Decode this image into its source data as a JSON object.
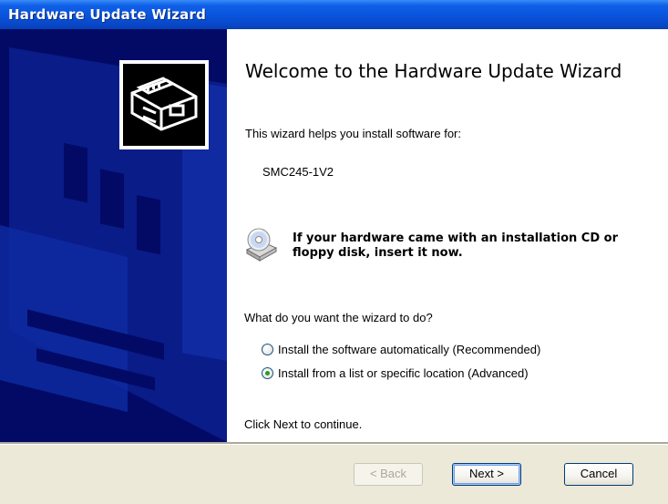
{
  "window": {
    "title": "Hardware Update Wizard"
  },
  "content": {
    "heading": "Welcome to the Hardware Update Wizard",
    "intro": "This wizard helps you install software for:",
    "device": "SMC245-1V2",
    "cd_note": "If your hardware came with an installation CD or floppy disk, insert it now.",
    "question": "What do you want the wizard to do?",
    "options": [
      {
        "label": "Install the software automatically (Recommended)",
        "selected": false
      },
      {
        "label": "Install from a list or specific location (Advanced)",
        "selected": true
      }
    ],
    "continue_text": "Click Next to continue."
  },
  "buttons": {
    "back": "< Back",
    "next": "Next >",
    "cancel": "Cancel"
  },
  "icons": {
    "wizard": "hardware-card-icon",
    "cd": "cd-drive-icon"
  },
  "colors": {
    "sidebar": "#030a66",
    "titlebar": "#0a55dd",
    "radio_dot": "#21a121"
  }
}
